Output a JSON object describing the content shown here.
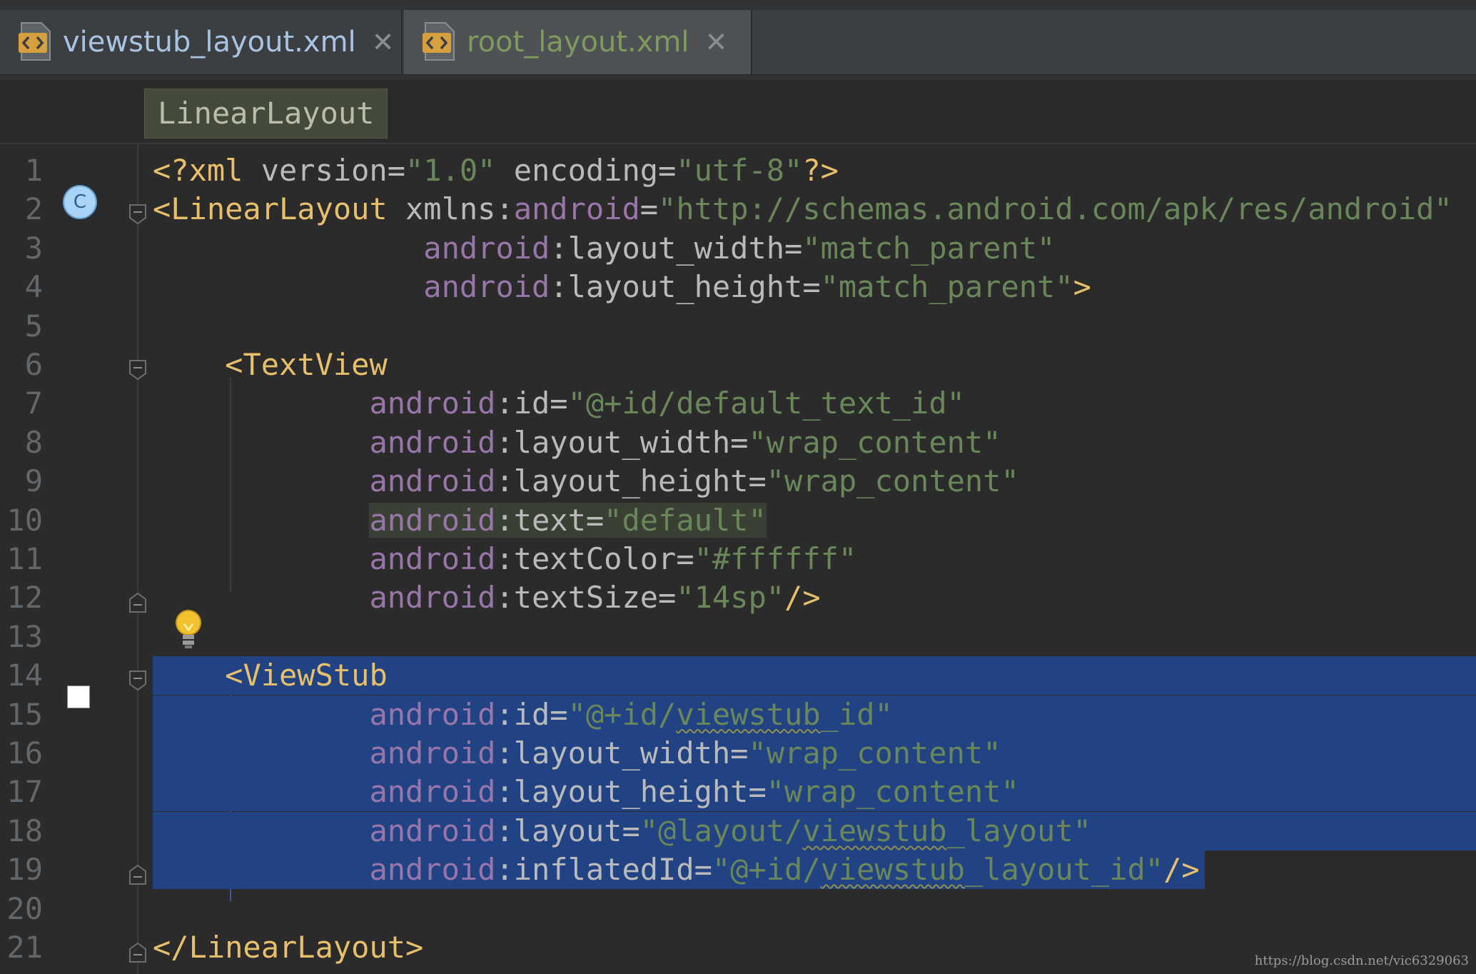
{
  "tabs": [
    {
      "label": "viewstub_layout.xml",
      "close": "✕",
      "icon": "xml-file-icon",
      "active": false
    },
    {
      "label": "root_layout.xml",
      "close": "✕",
      "icon": "xml-file-icon",
      "active": true
    }
  ],
  "breadcrumb": "LinearLayout",
  "watermark": "https://blog.csdn.net/vic6329063",
  "colors": {
    "tag": "#e8bf6a",
    "attribute": "#bababa",
    "namespace": "#9876aa",
    "value": "#6a8759",
    "selection": "#214283",
    "background": "#2b2b2b"
  },
  "lines": [
    {
      "n": "1",
      "tokens": [
        [
          "t",
          "<?xml "
        ],
        [
          "a",
          "version="
        ],
        [
          "v",
          "\"1.0\""
        ],
        [
          "a",
          " encoding="
        ],
        [
          "v",
          "\"utf-8\""
        ],
        [
          "t",
          "?>"
        ]
      ]
    },
    {
      "n": "2",
      "tokens": [
        [
          "t",
          "<LinearLayout "
        ],
        [
          "a",
          "xmlns:"
        ],
        [
          "ns",
          "android"
        ],
        [
          "a",
          "="
        ],
        [
          "v",
          "\"http://schemas.android.com/apk/res/android\""
        ]
      ]
    },
    {
      "n": "3",
      "tokens": [
        [
          "p",
          "               "
        ],
        [
          "ns",
          "android"
        ],
        [
          "a",
          ":layout_width="
        ],
        [
          "v",
          "\"match_parent\""
        ]
      ]
    },
    {
      "n": "4",
      "tokens": [
        [
          "p",
          "               "
        ],
        [
          "ns",
          "android"
        ],
        [
          "a",
          ":layout_height="
        ],
        [
          "v",
          "\"match_parent\""
        ],
        [
          "t",
          ">"
        ]
      ]
    },
    {
      "n": "5",
      "tokens": []
    },
    {
      "n": "6",
      "tokens": [
        [
          "p",
          "    "
        ],
        [
          "t",
          "<TextView"
        ]
      ]
    },
    {
      "n": "7",
      "tokens": [
        [
          "p",
          "            "
        ],
        [
          "ns",
          "android"
        ],
        [
          "a",
          ":id="
        ],
        [
          "v",
          "\"@+id/default_text_id\""
        ]
      ]
    },
    {
      "n": "8",
      "tokens": [
        [
          "p",
          "            "
        ],
        [
          "ns",
          "android"
        ],
        [
          "a",
          ":layout_width="
        ],
        [
          "v",
          "\"wrap_content\""
        ]
      ]
    },
    {
      "n": "9",
      "tokens": [
        [
          "p",
          "            "
        ],
        [
          "ns",
          "android"
        ],
        [
          "a",
          ":layout_height="
        ],
        [
          "v",
          "\"wrap_content\""
        ]
      ]
    },
    {
      "n": "10",
      "tokens": [
        [
          "p",
          "            "
        ],
        [
          "ns",
          "android"
        ],
        [
          "a",
          ":text="
        ],
        [
          "v",
          "\"default\""
        ]
      ]
    },
    {
      "n": "11",
      "tokens": [
        [
          "p",
          "            "
        ],
        [
          "ns",
          "android"
        ],
        [
          "a",
          ":textColor="
        ],
        [
          "v",
          "\"#ffffff\""
        ]
      ]
    },
    {
      "n": "12",
      "tokens": [
        [
          "p",
          "            "
        ],
        [
          "ns",
          "android"
        ],
        [
          "a",
          ":textSize="
        ],
        [
          "v",
          "\"14sp\""
        ],
        [
          "t",
          "/>"
        ]
      ]
    },
    {
      "n": "13",
      "tokens": []
    },
    {
      "n": "14",
      "tokens": [
        [
          "p",
          "    "
        ],
        [
          "t",
          "<ViewStub"
        ]
      ]
    },
    {
      "n": "15",
      "tokens": [
        [
          "p",
          "            "
        ],
        [
          "ns",
          "android"
        ],
        [
          "a",
          ":id="
        ],
        [
          "v",
          "\"@+id/"
        ],
        [
          "vs",
          "viewstub"
        ],
        [
          "v",
          "_id\""
        ]
      ]
    },
    {
      "n": "16",
      "tokens": [
        [
          "p",
          "            "
        ],
        [
          "ns",
          "android"
        ],
        [
          "a",
          ":layout_width="
        ],
        [
          "v",
          "\"wrap_content\""
        ]
      ]
    },
    {
      "n": "17",
      "tokens": [
        [
          "p",
          "            "
        ],
        [
          "ns",
          "android"
        ],
        [
          "a",
          ":layout_height="
        ],
        [
          "v",
          "\"wrap_content\""
        ]
      ]
    },
    {
      "n": "18",
      "tokens": [
        [
          "p",
          "            "
        ],
        [
          "ns",
          "android"
        ],
        [
          "a",
          ":layout="
        ],
        [
          "v",
          "\"@layout/"
        ],
        [
          "vs",
          "viewstub"
        ],
        [
          "v",
          "_layout\""
        ]
      ]
    },
    {
      "n": "19",
      "tokens": [
        [
          "p",
          "            "
        ],
        [
          "ns",
          "android"
        ],
        [
          "a",
          ":inflatedId="
        ],
        [
          "v",
          "\"@+id/"
        ],
        [
          "vs",
          "viewstub"
        ],
        [
          "v",
          "_layout_id\""
        ],
        [
          "t",
          "/>"
        ]
      ]
    },
    {
      "n": "20",
      "tokens": []
    },
    {
      "n": "21",
      "tokens": [
        [
          "t",
          "</LinearLayout>"
        ]
      ]
    }
  ]
}
